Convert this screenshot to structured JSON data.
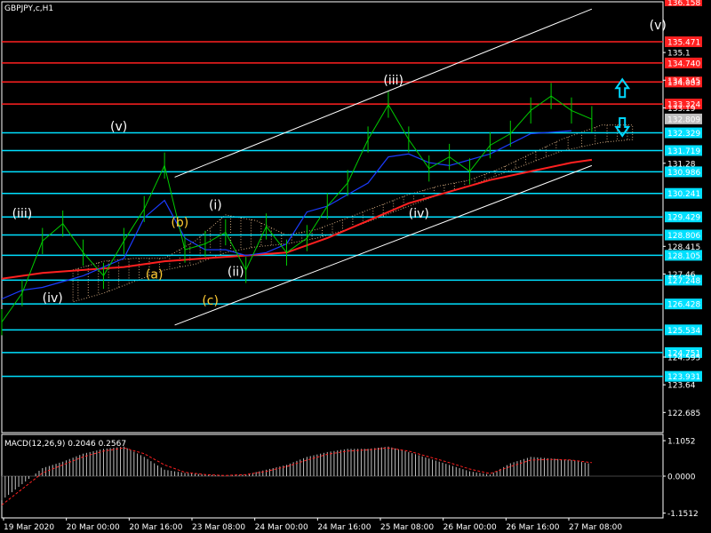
{
  "window": {
    "symbol_title": "GBPJPY,c,H1",
    "macd_title": "MACD(12,26,9) 0.2046 0.2567"
  },
  "colors": {
    "background": "#000000",
    "price_line": "#00cc00",
    "cloud": "#c8a27a",
    "ma_red": "#ff2020",
    "ma_blue": "#1b3cff",
    "channel": "#ffffff",
    "level_cyan": "#00e0ff",
    "level_red": "#ff2020",
    "label_yellow": "#ffcc33",
    "arrow": "#00d8ff"
  },
  "chart_data": {
    "type": "line",
    "price_range": [
      121.99,
      136.85
    ],
    "x_ticks": [
      "19 Mar 2020",
      "20 Mar 00:00",
      "20 Mar 16:00",
      "23 Mar 08:00",
      "24 Mar 00:00",
      "24 Mar 16:00",
      "25 Mar 08:00",
      "26 Mar 00:00",
      "26 Mar 16:00",
      "27 Mar 08:00"
    ],
    "y_axis_plain": [
      135.1,
      134.145,
      133.19,
      131.28,
      128.415,
      127.46,
      124.595,
      123.64,
      122.685
    ],
    "levels": [
      {
        "label": "135.471",
        "value": 135.471,
        "color": "red"
      },
      {
        "label": "134.740",
        "value": 134.74,
        "color": "red"
      },
      {
        "label": "134.083",
        "value": 134.083,
        "color": "red"
      },
      {
        "label": "133.324",
        "value": 133.324,
        "color": "red"
      },
      {
        "label": "132.329",
        "value": 132.329,
        "color": "cyan"
      },
      {
        "label": "131.719",
        "value": 131.719,
        "color": "cyan"
      },
      {
        "label": "130.986",
        "value": 130.986,
        "color": "cyan"
      },
      {
        "label": "130.241",
        "value": 130.241,
        "color": "cyan"
      },
      {
        "label": "129.429",
        "value": 129.429,
        "color": "cyan"
      },
      {
        "label": "128.806",
        "value": 128.806,
        "color": "cyan"
      },
      {
        "label": "128.105",
        "value": 128.105,
        "color": "cyan"
      },
      {
        "label": "127.248",
        "value": 127.248,
        "color": "cyan"
      },
      {
        "label": "126.428",
        "value": 126.428,
        "color": "cyan"
      },
      {
        "label": "125.534",
        "value": 125.534,
        "color": "cyan"
      },
      {
        "label": "124.751",
        "value": 124.751,
        "color": "cyan"
      },
      {
        "label": "123.931",
        "value": 123.931,
        "color": "cyan"
      }
    ],
    "top_edge_label": "136.158",
    "current_price": {
      "label": "132.809",
      "value": 132.809
    },
    "price_series": {
      "t": [
        0,
        4,
        8,
        12,
        16,
        20,
        24,
        28,
        32,
        36,
        40,
        44,
        48,
        52,
        56,
        60,
        64,
        68,
        72,
        76,
        80,
        84,
        88,
        92,
        96,
        100,
        104,
        108,
        112,
        116
      ],
      "values": [
        125.8,
        126.8,
        128.6,
        129.2,
        128.2,
        127.4,
        128.6,
        129.7,
        131.2,
        128.3,
        128.5,
        128.9,
        127.6,
        129.1,
        128.2,
        128.7,
        129.8,
        130.6,
        132.1,
        133.3,
        132.1,
        131.1,
        131.5,
        131.0,
        131.9,
        132.3,
        133.1,
        133.6,
        133.1,
        132.8
      ]
    },
    "ma_red": {
      "t": [
        0,
        8,
        16,
        24,
        32,
        40,
        48,
        56,
        64,
        72,
        80,
        88,
        96,
        104,
        112,
        116
      ],
      "values": [
        127.3,
        127.5,
        127.6,
        127.7,
        127.9,
        128.0,
        128.1,
        128.2,
        128.7,
        129.3,
        129.9,
        130.3,
        130.7,
        131.0,
        131.3,
        131.4
      ]
    },
    "ma_blue": {
      "t": [
        0,
        4,
        8,
        12,
        16,
        20,
        24,
        28,
        32,
        36,
        40,
        44,
        48,
        52,
        56,
        60,
        64,
        68,
        72,
        76,
        80,
        84,
        88,
        96,
        104,
        112
      ],
      "values": [
        126.6,
        126.9,
        127.0,
        127.2,
        127.4,
        127.7,
        128.0,
        129.4,
        130.0,
        128.7,
        128.3,
        128.3,
        128.1,
        128.2,
        128.5,
        129.6,
        129.8,
        130.2,
        130.6,
        131.5,
        131.6,
        131.3,
        131.2,
        131.6,
        132.3,
        132.4
      ]
    },
    "cloud": {
      "t": [
        14,
        20,
        26,
        32,
        38,
        44,
        50,
        56,
        62,
        68,
        74,
        80,
        86,
        92,
        98,
        104,
        110,
        118,
        124
      ],
      "upper": [
        127.6,
        127.9,
        128.0,
        128.0,
        128.6,
        129.5,
        129.3,
        128.8,
        129.0,
        129.4,
        129.8,
        130.2,
        130.5,
        130.7,
        131.1,
        131.6,
        132.1,
        132.6,
        132.6
      ],
      "lower": [
        126.5,
        126.8,
        127.2,
        127.6,
        127.8,
        128.2,
        128.4,
        128.5,
        128.7,
        129.0,
        129.4,
        129.8,
        130.2,
        130.5,
        130.9,
        131.3,
        131.7,
        132.0,
        132.1
      ]
    },
    "channel_lines": [
      {
        "t": [
          34,
          116
        ],
        "values": [
          130.8,
          136.6
        ]
      },
      {
        "t": [
          34,
          116
        ],
        "values": [
          125.7,
          131.2
        ]
      }
    ],
    "wave_labels": [
      {
        "text": "(iii)",
        "t": 4,
        "value": 129.4,
        "color": "white"
      },
      {
        "text": "(iv)",
        "t": 10,
        "value": 126.5,
        "color": "white"
      },
      {
        "text": "(v)",
        "t": 23,
        "value": 132.4,
        "color": "white"
      },
      {
        "text": "(a)",
        "t": 30,
        "value": 127.3,
        "color": "yellow"
      },
      {
        "text": "(b)",
        "t": 35,
        "value": 129.1,
        "color": "yellow"
      },
      {
        "text": "(c)",
        "t": 41,
        "value": 126.4,
        "color": "yellow"
      },
      {
        "text": "(i)",
        "t": 42,
        "value": 129.7,
        "color": "white"
      },
      {
        "text": "(ii)",
        "t": 46,
        "value": 127.4,
        "color": "white"
      },
      {
        "text": "(iii)",
        "t": 77,
        "value": 134.0,
        "color": "white"
      },
      {
        "text": "(iv)",
        "t": 82,
        "value": 129.4,
        "color": "white"
      },
      {
        "text": "(v)",
        "t": 129,
        "value": 135.9,
        "color": "white"
      }
    ],
    "arrows": [
      {
        "dir": "up",
        "t": 122,
        "value": 133.9
      },
      {
        "dir": "down",
        "t": 122,
        "value": 132.5
      }
    ],
    "macd": {
      "range": [
        -1.3,
        1.3
      ],
      "y_axis": [
        "1.1052",
        "0.0000",
        "-1.1512"
      ],
      "y_axis_values": [
        1.1052,
        0,
        -1.1512
      ],
      "hist_t": [
        0,
        4,
        8,
        12,
        16,
        20,
        24,
        28,
        32,
        36,
        40,
        44,
        48,
        52,
        56,
        60,
        64,
        68,
        72,
        76,
        80,
        84,
        88,
        92,
        96,
        100,
        104,
        108,
        112,
        116
      ],
      "hist": [
        -0.75,
        -0.25,
        0.25,
        0.45,
        0.7,
        0.85,
        0.92,
        0.6,
        0.2,
        0.1,
        0.05,
        0.0,
        0.05,
        0.2,
        0.35,
        0.6,
        0.75,
        0.85,
        0.85,
        0.92,
        0.75,
        0.55,
        0.35,
        0.15,
        0.05,
        0.4,
        0.6,
        0.55,
        0.5,
        0.38
      ],
      "signal": [
        -0.9,
        -0.4,
        0.1,
        0.35,
        0.6,
        0.78,
        0.88,
        0.7,
        0.35,
        0.12,
        0.05,
        0.02,
        0.05,
        0.15,
        0.3,
        0.5,
        0.68,
        0.78,
        0.82,
        0.88,
        0.78,
        0.6,
        0.42,
        0.22,
        0.08,
        0.3,
        0.5,
        0.52,
        0.5,
        0.42
      ]
    }
  }
}
